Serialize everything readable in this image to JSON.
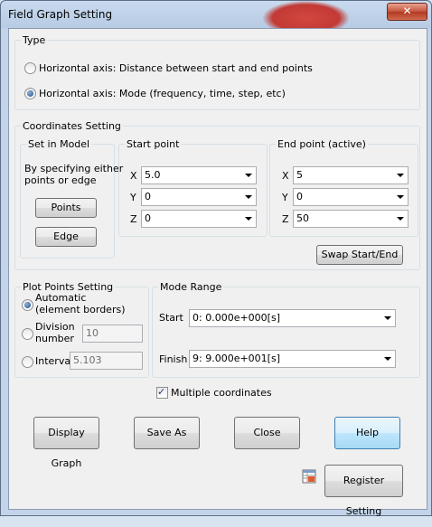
{
  "window": {
    "title": "Field Graph Setting",
    "close_glyph": "✕"
  },
  "type_group": {
    "legend": "Type",
    "options": [
      {
        "label": "Horizontal axis: Distance between start and end points",
        "selected": false
      },
      {
        "label": "Horizontal axis: Mode (frequency, time, step, etc)",
        "selected": true
      }
    ]
  },
  "coords": {
    "legend": "Coordinates Setting",
    "set_in_model": {
      "legend": "Set in Model",
      "desc_line1": "By specifying either",
      "desc_line2": "points or edge",
      "points_button": "Points",
      "edge_button": "Edge"
    },
    "start_point": {
      "legend": "Start point",
      "x_label": "X",
      "x_value": "5.0",
      "y_label": "Y",
      "y_value": "0",
      "z_label": "Z",
      "z_value": "0"
    },
    "end_point": {
      "legend": "End point (active)",
      "x_label": "X",
      "x_value": "5",
      "y_label": "Y",
      "y_value": "0",
      "z_label": "Z",
      "z_value": "50"
    },
    "swap_button": "Swap Start/End"
  },
  "plot_points": {
    "legend": "Plot Points Setting",
    "automatic_line1": "Automatic",
    "automatic_line2": "(element borders)",
    "division_line1": "Division",
    "division_line2": "number",
    "division_value": "10",
    "interval_label": "Interval",
    "interval_value": "5.103",
    "selected": "automatic"
  },
  "mode_range": {
    "legend": "Mode Range",
    "start_label": "Start",
    "start_value": "0: 0.000e+000[s]",
    "finish_label": "Finish",
    "finish_value": "9: 9.000e+001[s]"
  },
  "multiple_coordinates": {
    "label": "Multiple coordinates",
    "checked": true
  },
  "buttons": {
    "display_graph": "Display Graph",
    "save_as": "Save As",
    "close": "Close",
    "help": "Help",
    "register_setting": "Register Setting"
  }
}
